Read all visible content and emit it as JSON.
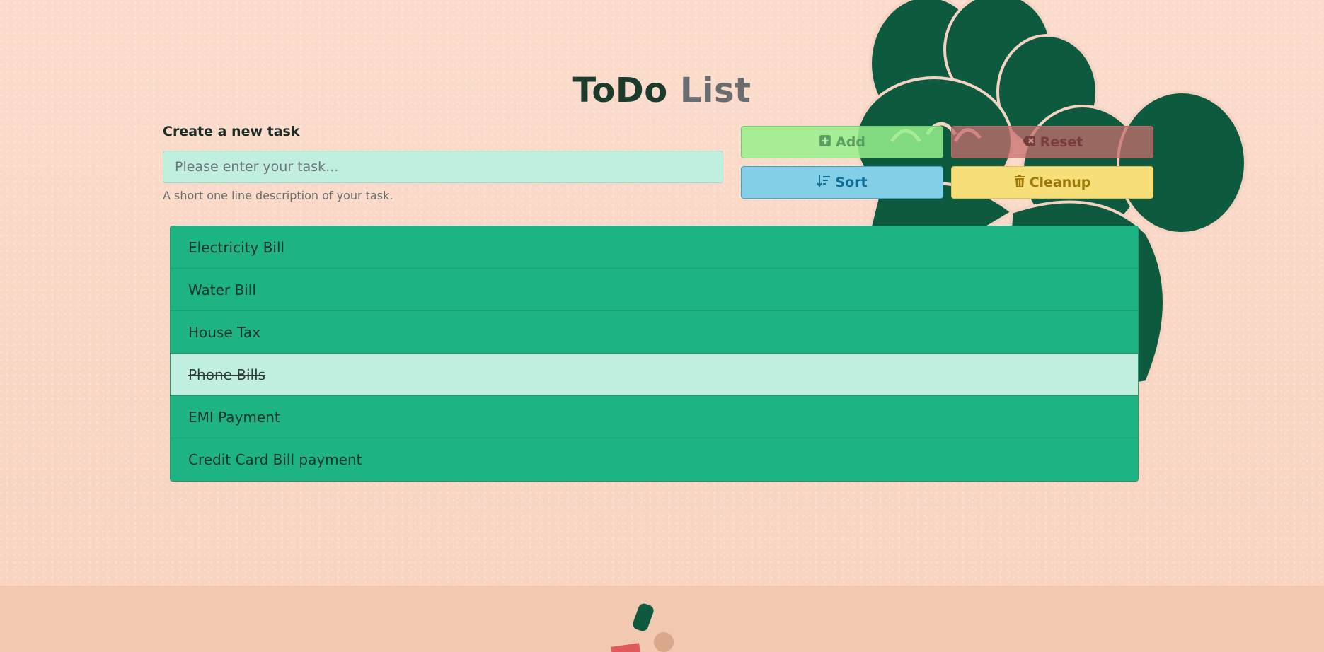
{
  "header": {
    "title_main": "ToDo",
    "title_accent": "List"
  },
  "form": {
    "label": "Create a new task",
    "placeholder": "Please enter your task...",
    "value": "",
    "help": "A short one line description of your task."
  },
  "buttons": {
    "add": {
      "label": "Add",
      "icon": "plus-square-icon"
    },
    "reset": {
      "label": "Reset",
      "icon": "x-square-icon"
    },
    "sort": {
      "label": "Sort",
      "icon": "sort-down-icon"
    },
    "cleanup": {
      "label": "Cleanup",
      "icon": "trash-icon"
    }
  },
  "tasks": [
    {
      "label": "Electricity Bill",
      "done": false
    },
    {
      "label": "Water Bill",
      "done": false
    },
    {
      "label": "House Tax",
      "done": false
    },
    {
      "label": "Phone Bills",
      "done": true
    },
    {
      "label": "EMI Payment",
      "done": false
    },
    {
      "label": "Credit Card Bill payment",
      "done": false
    }
  ],
  "colors": {
    "item_active": "#1eb385",
    "item_done": "#c1efdf",
    "plant": "#0d5a3f"
  }
}
